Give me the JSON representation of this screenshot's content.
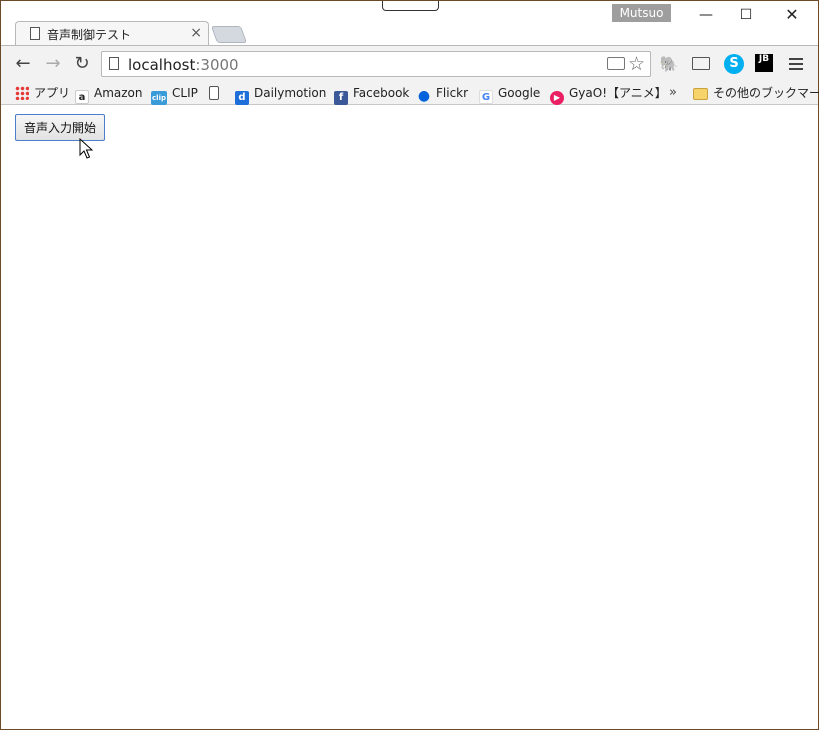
{
  "browser": {
    "tab": {
      "title": "音声制御テスト",
      "close_glyph": "×"
    },
    "profile_name": "Mutsuo",
    "window_controls": {
      "minimize": "—",
      "maximize": "☐",
      "close": "✕"
    },
    "nav": {
      "back": "←",
      "forward": "→",
      "reload": "↻"
    },
    "url": {
      "host": "localhost",
      "port": ":3000"
    },
    "extensions": {
      "skype": "S",
      "jb": "JB"
    },
    "bookmarks": [
      {
        "label": "アプリ",
        "icon": "apps-grid-icon"
      },
      {
        "label": "Amazon",
        "icon": "amazon-icon"
      },
      {
        "label": "CLIP",
        "icon": "clip-icon"
      },
      {
        "label": "",
        "icon": "page-icon"
      },
      {
        "label": "Dailymotion",
        "icon": "dailymotion-icon"
      },
      {
        "label": "Facebook",
        "icon": "facebook-icon"
      },
      {
        "label": "Flickr",
        "icon": "flickr-icon"
      },
      {
        "label": "Google",
        "icon": "google-icon"
      },
      {
        "label": "GyaO!【アニメ】",
        "icon": "gyao-icon"
      }
    ],
    "bookmarks_more": "»",
    "other_bookmarks": "その他のブックマーク"
  },
  "page": {
    "start_button_label": "音声入力開始"
  }
}
